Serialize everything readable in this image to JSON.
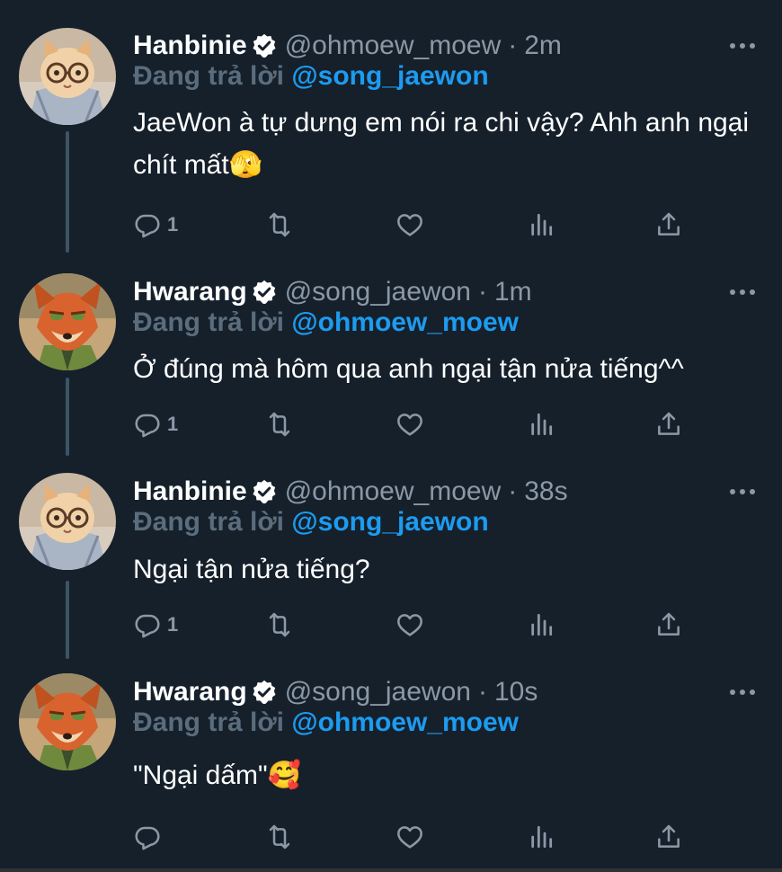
{
  "theme": {
    "background": "#15202b",
    "text": "#ffffff",
    "muted": "#8b98a5",
    "accent": "#1d9bf0",
    "verified_badge": "#ffffff"
  },
  "tweets": [
    {
      "display_name": "Hanbinie",
      "handle": "@ohmoew_moew",
      "time": "2m",
      "reply_prefix": "Đang trả lời",
      "reply_handle": "@song_jaewon",
      "text": "JaeWon à tự dưng em nói ra chi vậy? Ahh anh ngại chít mất🫣",
      "reply_count": "1",
      "avatar": "cat-avatar-icon"
    },
    {
      "display_name": "Hwarang",
      "handle": "@song_jaewon",
      "time": "1m",
      "reply_prefix": "Đang trả lời",
      "reply_handle": "@ohmoew_moew",
      "text": "Ở đúng mà hôm qua anh ngại tận nửa tiếng^^",
      "reply_count": "1",
      "avatar": "fox-avatar-icon"
    },
    {
      "display_name": "Hanbinie",
      "handle": "@ohmoew_moew",
      "time": "38s",
      "reply_prefix": "Đang trả lời",
      "reply_handle": "@song_jaewon",
      "text": "Ngại tận nửa tiếng?",
      "reply_count": "1",
      "avatar": "cat-avatar-icon"
    },
    {
      "display_name": "Hwarang",
      "handle": "@song_jaewon",
      "time": "10s",
      "reply_prefix": "Đang trả lời",
      "reply_handle": "@ohmoew_moew",
      "text": "\"Ngại dấm\"🥰",
      "reply_count": "",
      "avatar": "fox-avatar-icon"
    }
  ]
}
